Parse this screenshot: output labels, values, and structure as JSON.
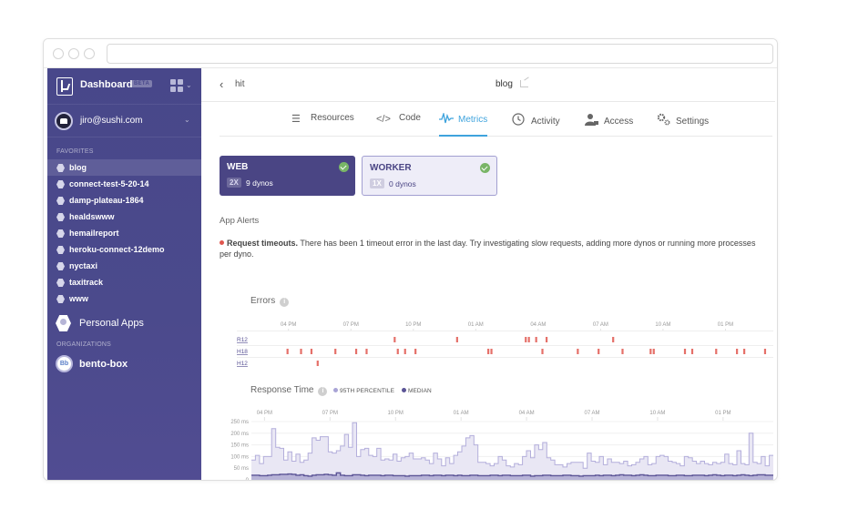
{
  "browser": {
    "url": ""
  },
  "sidebar": {
    "title": "Dashboard",
    "badge": "BETA",
    "user": {
      "email": "jiro@sushi.com"
    },
    "favorites_label": "FAVORITES",
    "favorites": [
      {
        "label": "blog",
        "active": true
      },
      {
        "label": "connect-test-5-20-14"
      },
      {
        "label": "damp-plateau-1864"
      },
      {
        "label": "healdswww"
      },
      {
        "label": "hemailreport"
      },
      {
        "label": "heroku-connect-12demo"
      },
      {
        "label": "nyctaxi"
      },
      {
        "label": "taxitrack"
      },
      {
        "label": "www"
      }
    ],
    "personal_apps": "Personal Apps",
    "organizations_label": "ORGANIZATIONS",
    "organizations": [
      {
        "label": "bento-box",
        "initials": "Bb"
      }
    ]
  },
  "header": {
    "back_label": "hit",
    "app_name": "blog"
  },
  "tabs": [
    {
      "label": "Resources",
      "icon": "sliders-icon"
    },
    {
      "label": "Code",
      "icon": "code-icon"
    },
    {
      "label": "Metrics",
      "icon": "pulse-icon",
      "active": true
    },
    {
      "label": "Activity",
      "icon": "clock-icon"
    },
    {
      "label": "Access",
      "icon": "user-lock-icon"
    },
    {
      "label": "Settings",
      "icon": "gears-icon"
    }
  ],
  "dynos": [
    {
      "name": "WEB",
      "size": "2X",
      "count": "9 dynos",
      "status": "ok"
    },
    {
      "name": "WORKER",
      "size": "1X",
      "count": "0 dynos",
      "status": "ok"
    }
  ],
  "alerts": {
    "title": "App Alerts",
    "items": [
      {
        "bold": "Request timeouts.",
        "text": " There has been 1 timeout error in the last day. Try investigating slow requests, adding more dynos or running more processes per dyno."
      }
    ]
  },
  "colors": {
    "accent": "#3ea3dd",
    "sidebar": "#48478a",
    "error": "#e0574f",
    "p95": "#a9a4d6",
    "median": "#5b5496"
  },
  "chart_data": [
    {
      "type": "scatter",
      "title": "Errors",
      "x_unit": "hours since 04 PM",
      "xlim": [
        -0.6,
        23.3
      ],
      "x_ticks": [
        "04 PM",
        "07 PM",
        "10 PM",
        "01 AM",
        "04 AM",
        "07 AM",
        "10 AM",
        "01 PM"
      ],
      "x_tick_hours": [
        0,
        3,
        6,
        9,
        12,
        15,
        18,
        21
      ],
      "series": [
        {
          "name": "R12",
          "x": [
            5.1,
            8.1,
            11.4,
            11.55,
            11.9,
            12.4,
            15.6
          ]
        },
        {
          "name": "H18",
          "x": [
            -0.05,
            0.6,
            1.1,
            2.25,
            3.25,
            3.75,
            5.25,
            5.6,
            6.1,
            9.6,
            9.75,
            12.2,
            13.9,
            14.9,
            16.05,
            17.4,
            17.55,
            19.05,
            19.4,
            20.55,
            21.55,
            21.9,
            22.9
          ]
        },
        {
          "name": "H12",
          "x": [
            1.4
          ]
        }
      ]
    },
    {
      "type": "area",
      "title": "Response Time",
      "legend": [
        "95TH PERCENTILE",
        "MEDIAN"
      ],
      "ylabel": "ms",
      "ylim": [
        0,
        250
      ],
      "y_ticks": [
        "0",
        "50 ms",
        "100 ms",
        "150 ms",
        "200 ms",
        "250 ms"
      ],
      "y_tick_values": [
        0,
        50,
        100,
        150,
        200,
        250
      ],
      "x_ticks": [
        "04 PM",
        "07 PM",
        "10 PM",
        "01 AM",
        "04 AM",
        "07 AM",
        "10 AM",
        "01 PM"
      ],
      "x_tick_hours": [
        0,
        3,
        6,
        9,
        12,
        15,
        18,
        21
      ],
      "x_start_hour": -0.6,
      "step_hours": 0.25,
      "series": [
        {
          "name": "95TH PERCENTILE",
          "values": [
            85,
            105,
            70,
            100,
            100,
            220,
            140,
            135,
            85,
            120,
            80,
            110,
            75,
            85,
            115,
            180,
            170,
            185,
            185,
            120,
            115,
            125,
            145,
            195,
            140,
            245,
            100,
            130,
            135,
            105,
            100,
            135,
            85,
            90,
            85,
            110,
            80,
            95,
            100,
            115,
            90,
            90,
            95,
            85,
            70,
            115,
            90,
            60,
            95,
            70,
            105,
            120,
            145,
            180,
            190,
            150,
            75,
            75,
            70,
            60,
            70,
            100,
            85,
            60,
            55,
            70,
            65,
            100,
            125,
            95,
            150,
            130,
            160,
            95,
            85,
            65,
            65,
            55,
            70,
            75,
            75,
            75,
            50,
            115,
            80,
            75,
            100,
            65,
            90,
            75,
            75,
            70,
            80,
            60,
            65,
            75,
            90,
            100,
            65,
            70,
            100,
            105,
            100,
            80,
            75,
            70,
            60,
            100,
            95,
            80,
            70,
            80,
            70,
            65,
            75,
            70,
            75,
            110,
            70,
            65,
            125,
            70,
            65,
            200,
            75,
            70,
            100,
            60,
            105
          ]
        },
        {
          "name": "MEDIAN",
          "values": [
            20,
            20,
            18,
            18,
            20,
            22,
            22,
            24,
            24,
            25,
            24,
            20,
            22,
            18,
            16,
            20,
            22,
            22,
            24,
            22,
            20,
            30,
            20,
            18,
            18,
            22,
            22,
            20,
            18,
            20,
            20,
            20,
            18,
            20,
            20,
            18,
            18,
            18,
            16,
            18,
            18,
            18,
            20,
            20,
            18,
            20,
            20,
            18,
            20,
            20,
            18,
            20,
            18,
            18,
            20,
            20,
            18,
            18,
            18,
            20,
            20,
            18,
            20,
            20,
            18,
            18,
            18,
            20,
            20,
            16,
            18,
            18,
            20,
            20,
            18,
            18,
            18,
            20,
            20,
            18,
            18,
            16,
            18,
            18,
            18,
            20,
            18,
            20,
            20,
            18,
            20,
            22,
            20,
            20,
            18,
            20,
            22,
            20,
            18,
            18,
            20,
            20,
            20,
            18,
            18,
            20,
            20,
            18,
            18,
            20,
            20,
            20,
            18,
            20,
            22,
            20,
            18,
            20,
            20,
            18,
            20,
            22,
            20,
            18,
            20,
            22,
            22,
            20,
            20
          ]
        }
      ]
    }
  ]
}
